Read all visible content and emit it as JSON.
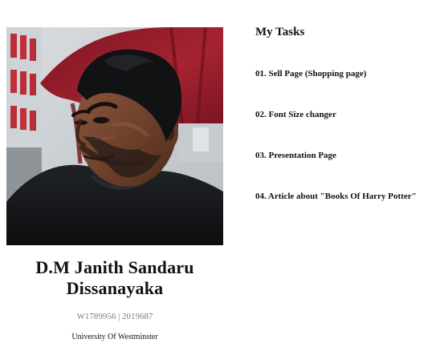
{
  "profile": {
    "name": "D.M Janith Sandaru Dissanayaka",
    "ids": "W1789956 | 2019687",
    "university": "University Of Westminster",
    "photo_icon": "profile-photo"
  },
  "tasks": {
    "title": "My Tasks",
    "items": [
      {
        "label": "01. Sell Page (Shopping page)"
      },
      {
        "label": "02. Font Size changer"
      },
      {
        "label": "03. Presentation Page"
      },
      {
        "label": "04. Article about \"Books Of Harry Potter\""
      }
    ]
  },
  "colors": {
    "text": "#111111",
    "muted_text": "#7b7b7b",
    "background": "#ffffff",
    "shirt": "#151719",
    "umbrella": "#9e1d2a"
  }
}
